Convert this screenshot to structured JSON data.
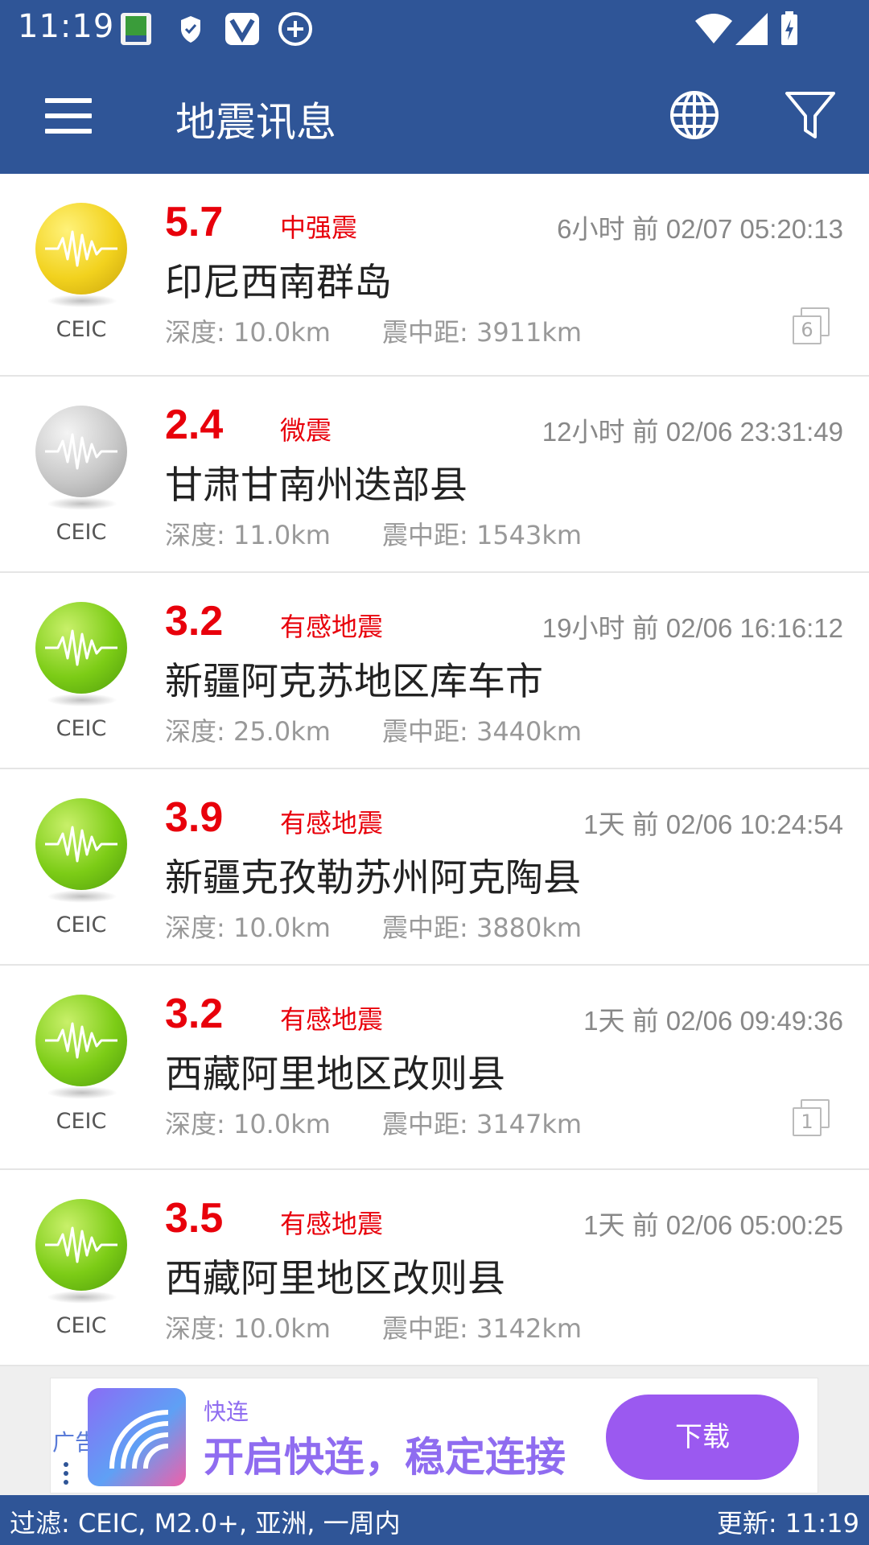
{
  "status_bar": {
    "time": "11:19"
  },
  "app_bar": {
    "title": "地震讯息",
    "menu_icon": "menu-icon",
    "globe_icon": "globe-icon",
    "filter_icon": "filter-icon"
  },
  "colors": {
    "primary": "#2f5597",
    "magnitude": "#e8000b",
    "yellow_ball": "#f2d21e",
    "gray_ball": "#c8c8c8",
    "green_ball": "#7ccc16",
    "ad_purple": "#9b59f0"
  },
  "quakes": [
    {
      "magnitude": "5.7",
      "level": "中强震",
      "time": "6小时 前 02/07 05:20:13",
      "place": "印尼西南群岛",
      "depth": "深度: 10.0km",
      "distance": "震中距: 3911km",
      "source": "CEIC",
      "ball": "yellow",
      "count": "6"
    },
    {
      "magnitude": "2.4",
      "level": "微震",
      "time": "12小时 前 02/06 23:31:49",
      "place": "甘肃甘南州迭部县",
      "depth": "深度: 11.0km",
      "distance": "震中距: 1543km",
      "source": "CEIC",
      "ball": "gray"
    },
    {
      "magnitude": "3.2",
      "level": "有感地震",
      "time": "19小时 前 02/06 16:16:12",
      "place": "新疆阿克苏地区库车市",
      "depth": "深度: 25.0km",
      "distance": "震中距: 3440km",
      "source": "CEIC",
      "ball": "green"
    },
    {
      "magnitude": "3.9",
      "level": "有感地震",
      "time": "1天 前 02/06 10:24:54",
      "place": "新疆克孜勒苏州阿克陶县",
      "depth": "深度: 10.0km",
      "distance": "震中距: 3880km",
      "source": "CEIC",
      "ball": "green"
    },
    {
      "magnitude": "3.2",
      "level": "有感地震",
      "time": "1天 前 02/06 09:49:36",
      "place": "西藏阿里地区改则县",
      "depth": "深度: 10.0km",
      "distance": "震中距: 3147km",
      "source": "CEIC",
      "ball": "green",
      "count": "1"
    },
    {
      "magnitude": "3.5",
      "level": "有感地震",
      "time": "1天 前 02/06 05:00:25",
      "place": "西藏阿里地区改则县",
      "depth": "深度: 10.0km",
      "distance": "震中距: 3142km",
      "source": "CEIC",
      "ball": "green"
    }
  ],
  "ad": {
    "badge": "广告",
    "app_name": "快连",
    "slogan": "开启快连，稳定连接",
    "button": "下载"
  },
  "footer": {
    "filter": "过滤: CEIC, M2.0+, 亚洲, 一周内",
    "updated": "更新: 11:19"
  }
}
